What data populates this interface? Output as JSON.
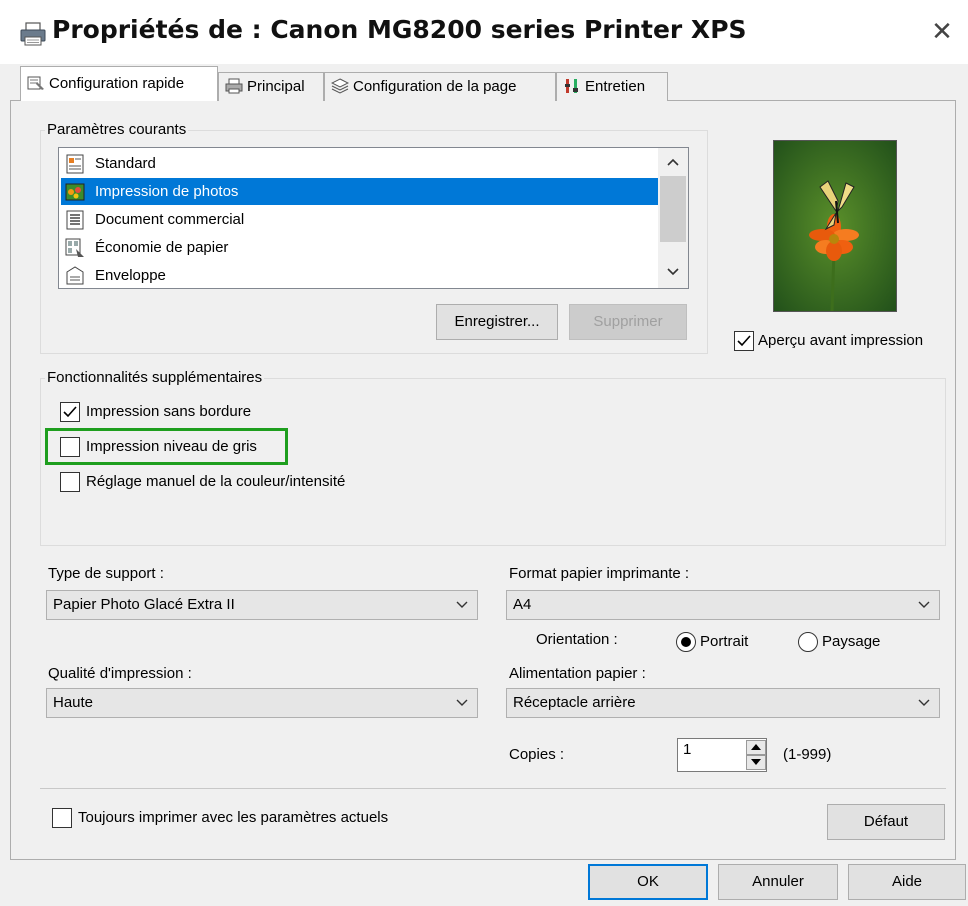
{
  "window": {
    "title": "Propriétés de : Canon MG8200 series Printer XPS",
    "close_glyph": "✕"
  },
  "tabs": [
    {
      "label": "Configuration rapide",
      "active": true
    },
    {
      "label": "Principal"
    },
    {
      "label": "Configuration de la page"
    },
    {
      "label": "Entretien"
    }
  ],
  "current_settings": {
    "legend": "Paramètres courants",
    "items": [
      {
        "label": "Standard"
      },
      {
        "label": "Impression de photos",
        "selected": true
      },
      {
        "label": "Document commercial"
      },
      {
        "label": "Économie de papier"
      },
      {
        "label": "Enveloppe"
      }
    ],
    "save_button": "Enregistrer...",
    "delete_button": "Supprimer"
  },
  "preview": {
    "checkbox_label": "Aperçu avant impression",
    "checked": true
  },
  "extra_features": {
    "legend": "Fonctionnalités supplémentaires",
    "options": [
      {
        "label": "Impression sans bordure",
        "checked": true
      },
      {
        "label": "Impression niveau de gris",
        "checked": false,
        "highlight_color": "#1e9e1e"
      },
      {
        "label": "Réglage manuel de la couleur/intensité",
        "checked": false
      }
    ]
  },
  "media_type": {
    "label": "Type de support :",
    "value": "Papier Photo Glacé Extra II"
  },
  "paper_size": {
    "label": "Format papier imprimante :",
    "value": "A4"
  },
  "orientation": {
    "label": "Orientation :",
    "portrait": "Portrait",
    "landscape": "Paysage",
    "selected": "Portrait"
  },
  "print_quality": {
    "label": "Qualité d'impression :",
    "value": "Haute"
  },
  "paper_source": {
    "label": "Alimentation papier :",
    "value": "Réceptacle arrière"
  },
  "copies": {
    "label": "Copies :",
    "value": "1",
    "range": "(1-999)"
  },
  "always_print_current": {
    "label": "Toujours imprimer avec les paramètres actuels",
    "checked": false
  },
  "default_button": "Défaut",
  "footer": {
    "ok": "OK",
    "cancel": "Annuler",
    "help": "Aide"
  },
  "colors": {
    "selection": "#0078d7",
    "highlight_box": "#1e9e1e"
  }
}
